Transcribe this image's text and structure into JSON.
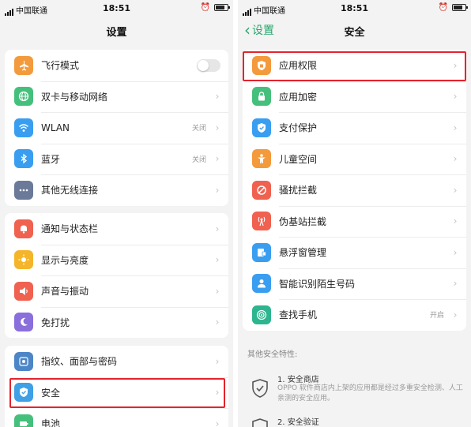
{
  "status_bar": {
    "carrier": "中国联通",
    "time": "18:51"
  },
  "left": {
    "title": "设置",
    "groups": [
      {
        "items": [
          {
            "label": "飞行模式",
            "icon": "airplane-icon",
            "color": "#f39a3c",
            "toggle": true
          },
          {
            "label": "双卡与移动网络",
            "icon": "globe-icon",
            "color": "#45c07c"
          },
          {
            "label": "WLAN",
            "icon": "wifi-icon",
            "color": "#3a9ef0",
            "value": "关闭"
          },
          {
            "label": "蓝牙",
            "icon": "bluetooth-icon",
            "color": "#3a9ef0",
            "value": "关闭"
          },
          {
            "label": "其他无线连接",
            "icon": "more-dots-icon",
            "color": "#6b7a99"
          }
        ]
      },
      {
        "items": [
          {
            "label": "通知与状态栏",
            "icon": "bell-icon",
            "color": "#f0614f"
          },
          {
            "label": "显示与亮度",
            "icon": "sun-icon",
            "color": "#f5b52b"
          },
          {
            "label": "声音与振动",
            "icon": "speaker-icon",
            "color": "#f0614f"
          },
          {
            "label": "免打扰",
            "icon": "moon-icon",
            "color": "#8a6fdc"
          }
        ]
      },
      {
        "items": [
          {
            "label": "指纹、面部与密码",
            "icon": "fingerprint-icon",
            "color": "#4c86c7"
          },
          {
            "label": "安全",
            "icon": "shield-icon",
            "color": "#3fa0e6"
          },
          {
            "label": "电池",
            "icon": "battery-icon",
            "color": "#45c07c"
          }
        ]
      }
    ]
  },
  "right": {
    "back_label": "设置",
    "title": "安全",
    "items": [
      {
        "label": "应用权限",
        "icon": "shield-app-icon",
        "color": "#f39a3c"
      },
      {
        "label": "应用加密",
        "icon": "lock-icon",
        "color": "#45c07c"
      },
      {
        "label": "支付保护",
        "icon": "shield-check-icon",
        "color": "#3a9ef0"
      },
      {
        "label": "儿童空间",
        "icon": "child-icon",
        "color": "#f39a3c"
      },
      {
        "label": "骚扰拦截",
        "icon": "block-icon",
        "color": "#f0614f"
      },
      {
        "label": "伪基站拦截",
        "icon": "tower-icon",
        "color": "#f0614f"
      },
      {
        "label": "悬浮窗管理",
        "icon": "floating-window-icon",
        "color": "#3a9ef0"
      },
      {
        "label": "智能识别陌生号码",
        "icon": "person-icon",
        "color": "#3a9ef0"
      },
      {
        "label": "查找手机",
        "icon": "radar-icon",
        "color": "#2db58f",
        "value": "开启"
      }
    ],
    "features_title": "其他安全特性:",
    "features": [
      {
        "title": "1. 安全商店",
        "desc": "OPPO 软件商店内上架的应用都是经过多重安全检测、人工亲测的安全应用。"
      },
      {
        "title": "2. 安全验证",
        "desc": ""
      }
    ]
  }
}
